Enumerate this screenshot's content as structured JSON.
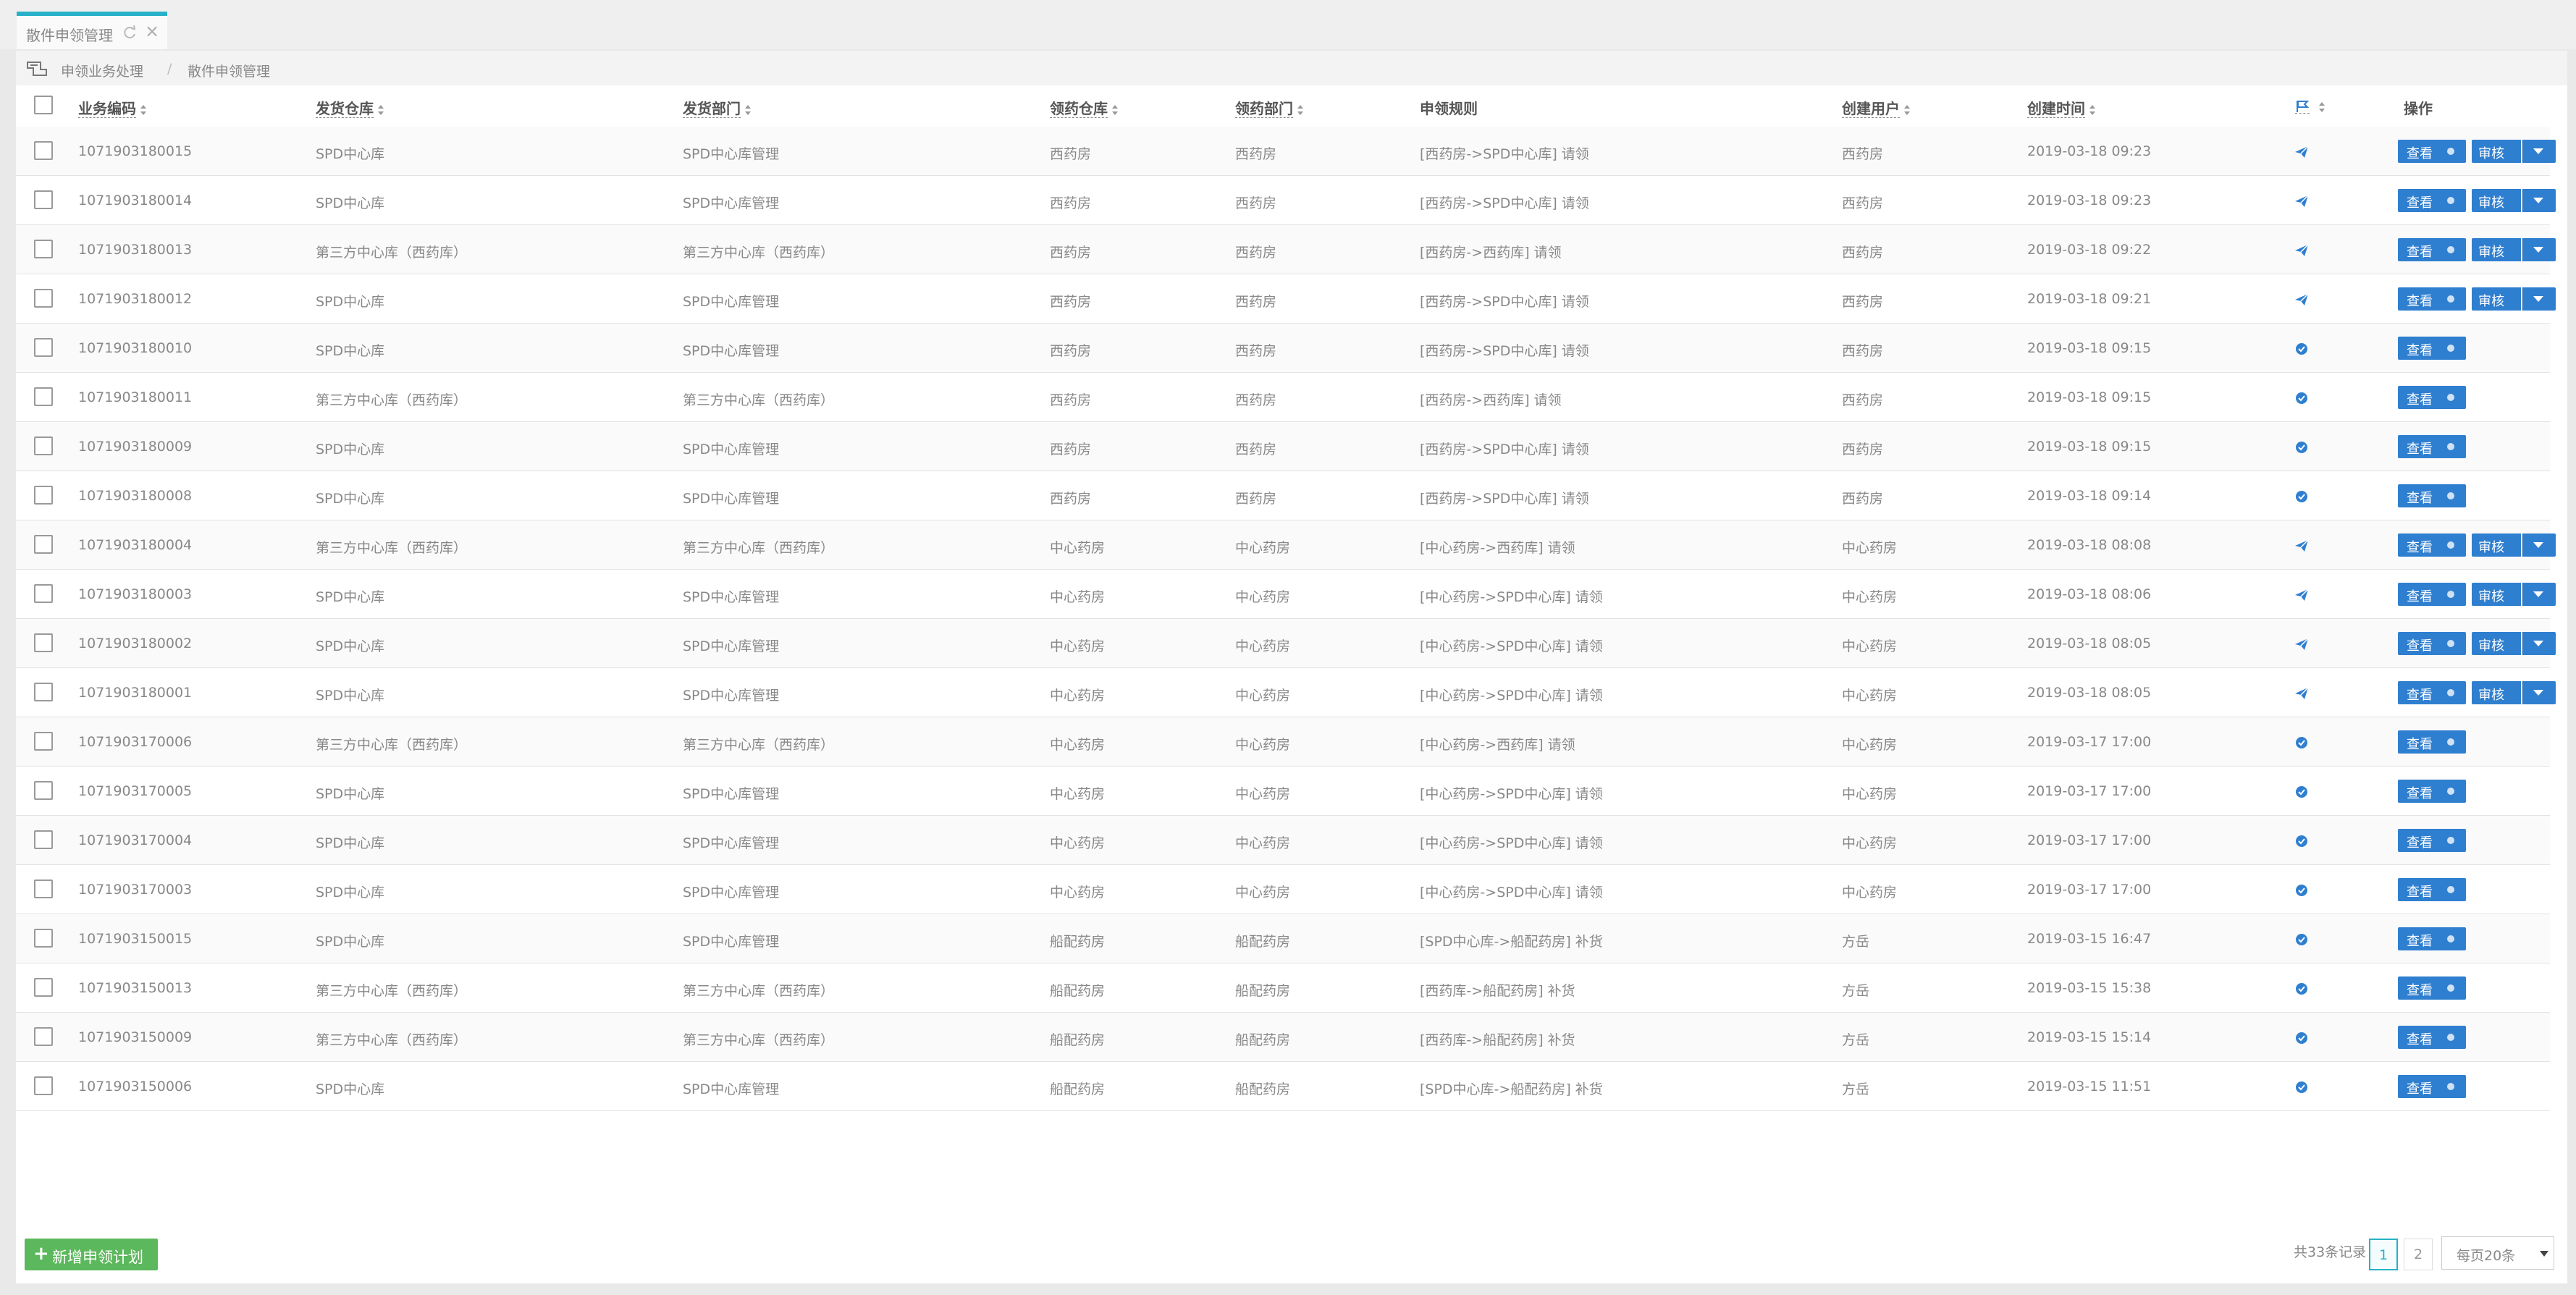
{
  "tab": {
    "label": "散件申领管理"
  },
  "breadcrumb": {
    "items": [
      "申领业务处理",
      "散件申领管理"
    ],
    "separator": "/"
  },
  "grid": {
    "columns": {
      "code": "业务编码",
      "src_wh": "发货仓库",
      "src_dept": "发货部门",
      "dst_wh": "领药仓库",
      "dst_dept": "领药部门",
      "rule": "申领规则",
      "user": "创建用户",
      "time": "创建时间",
      "actions": "操作"
    },
    "view_label": "查看",
    "audit_label": "审核",
    "rows": [
      {
        "code": "1071903180015",
        "src_wh": "SPD中心库",
        "src_dept": "SPD中心库管理",
        "dst_wh": "西药房",
        "dst_dept": "西药房",
        "rule": "[西药房->SPD中心库] 请领",
        "user": "西药房",
        "time": "2019-03-18 09:23",
        "status": "sent"
      },
      {
        "code": "1071903180014",
        "src_wh": "SPD中心库",
        "src_dept": "SPD中心库管理",
        "dst_wh": "西药房",
        "dst_dept": "西药房",
        "rule": "[西药房->SPD中心库] 请领",
        "user": "西药房",
        "time": "2019-03-18 09:23",
        "status": "sent"
      },
      {
        "code": "1071903180013",
        "src_wh": "第三方中心库（西药库）",
        "src_dept": "第三方中心库（西药库）",
        "dst_wh": "西药房",
        "dst_dept": "西药房",
        "rule": "[西药房->西药库] 请领",
        "user": "西药房",
        "time": "2019-03-18 09:22",
        "status": "sent"
      },
      {
        "code": "1071903180012",
        "src_wh": "SPD中心库",
        "src_dept": "SPD中心库管理",
        "dst_wh": "西药房",
        "dst_dept": "西药房",
        "rule": "[西药房->SPD中心库] 请领",
        "user": "西药房",
        "time": "2019-03-18 09:21",
        "status": "sent"
      },
      {
        "code": "1071903180010",
        "src_wh": "SPD中心库",
        "src_dept": "SPD中心库管理",
        "dst_wh": "西药房",
        "dst_dept": "西药房",
        "rule": "[西药房->SPD中心库] 请领",
        "user": "西药房",
        "time": "2019-03-18 09:15",
        "status": "done"
      },
      {
        "code": "1071903180011",
        "src_wh": "第三方中心库（西药库）",
        "src_dept": "第三方中心库（西药库）",
        "dst_wh": "西药房",
        "dst_dept": "西药房",
        "rule": "[西药房->西药库] 请领",
        "user": "西药房",
        "time": "2019-03-18 09:15",
        "status": "done"
      },
      {
        "code": "1071903180009",
        "src_wh": "SPD中心库",
        "src_dept": "SPD中心库管理",
        "dst_wh": "西药房",
        "dst_dept": "西药房",
        "rule": "[西药房->SPD中心库] 请领",
        "user": "西药房",
        "time": "2019-03-18 09:15",
        "status": "done"
      },
      {
        "code": "1071903180008",
        "src_wh": "SPD中心库",
        "src_dept": "SPD中心库管理",
        "dst_wh": "西药房",
        "dst_dept": "西药房",
        "rule": "[西药房->SPD中心库] 请领",
        "user": "西药房",
        "time": "2019-03-18 09:14",
        "status": "done"
      },
      {
        "code": "1071903180004",
        "src_wh": "第三方中心库（西药库）",
        "src_dept": "第三方中心库（西药库）",
        "dst_wh": "中心药房",
        "dst_dept": "中心药房",
        "rule": "[中心药房->西药库] 请领",
        "user": "中心药房",
        "time": "2019-03-18 08:08",
        "status": "sent"
      },
      {
        "code": "1071903180003",
        "src_wh": "SPD中心库",
        "src_dept": "SPD中心库管理",
        "dst_wh": "中心药房",
        "dst_dept": "中心药房",
        "rule": "[中心药房->SPD中心库] 请领",
        "user": "中心药房",
        "time": "2019-03-18 08:06",
        "status": "sent"
      },
      {
        "code": "1071903180002",
        "src_wh": "SPD中心库",
        "src_dept": "SPD中心库管理",
        "dst_wh": "中心药房",
        "dst_dept": "中心药房",
        "rule": "[中心药房->SPD中心库] 请领",
        "user": "中心药房",
        "time": "2019-03-18 08:05",
        "status": "sent"
      },
      {
        "code": "1071903180001",
        "src_wh": "SPD中心库",
        "src_dept": "SPD中心库管理",
        "dst_wh": "中心药房",
        "dst_dept": "中心药房",
        "rule": "[中心药房->SPD中心库] 请领",
        "user": "中心药房",
        "time": "2019-03-18 08:05",
        "status": "sent"
      },
      {
        "code": "1071903170006",
        "src_wh": "第三方中心库（西药库）",
        "src_dept": "第三方中心库（西药库）",
        "dst_wh": "中心药房",
        "dst_dept": "中心药房",
        "rule": "[中心药房->西药库] 请领",
        "user": "中心药房",
        "time": "2019-03-17 17:00",
        "status": "done"
      },
      {
        "code": "1071903170005",
        "src_wh": "SPD中心库",
        "src_dept": "SPD中心库管理",
        "dst_wh": "中心药房",
        "dst_dept": "中心药房",
        "rule": "[中心药房->SPD中心库] 请领",
        "user": "中心药房",
        "time": "2019-03-17 17:00",
        "status": "done"
      },
      {
        "code": "1071903170004",
        "src_wh": "SPD中心库",
        "src_dept": "SPD中心库管理",
        "dst_wh": "中心药房",
        "dst_dept": "中心药房",
        "rule": "[中心药房->SPD中心库] 请领",
        "user": "中心药房",
        "time": "2019-03-17 17:00",
        "status": "done"
      },
      {
        "code": "1071903170003",
        "src_wh": "SPD中心库",
        "src_dept": "SPD中心库管理",
        "dst_wh": "中心药房",
        "dst_dept": "中心药房",
        "rule": "[中心药房->SPD中心库] 请领",
        "user": "中心药房",
        "time": "2019-03-17 17:00",
        "status": "done"
      },
      {
        "code": "1071903150015",
        "src_wh": "SPD中心库",
        "src_dept": "SPD中心库管理",
        "dst_wh": "船配药房",
        "dst_dept": "船配药房",
        "rule": "[SPD中心库->船配药房] 补货",
        "user": "方岳",
        "time": "2019-03-15 16:47",
        "status": "done"
      },
      {
        "code": "1071903150013",
        "src_wh": "第三方中心库（西药库）",
        "src_dept": "第三方中心库（西药库）",
        "dst_wh": "船配药房",
        "dst_dept": "船配药房",
        "rule": "[西药库->船配药房] 补货",
        "user": "方岳",
        "time": "2019-03-15 15:38",
        "status": "done"
      },
      {
        "code": "1071903150009",
        "src_wh": "第三方中心库（西药库）",
        "src_dept": "第三方中心库（西药库）",
        "dst_wh": "船配药房",
        "dst_dept": "船配药房",
        "rule": "[西药库->船配药房] 补货",
        "user": "方岳",
        "time": "2019-03-15 15:14",
        "status": "done"
      },
      {
        "code": "1071903150006",
        "src_wh": "SPD中心库",
        "src_dept": "SPD中心库管理",
        "dst_wh": "船配药房",
        "dst_dept": "船配药房",
        "rule": "[SPD中心库->船配药房] 补货",
        "user": "方岳",
        "time": "2019-03-15 11:51",
        "status": "done"
      }
    ]
  },
  "footer": {
    "add_label": "新增申领计划",
    "total_text": "共33条记录",
    "pages": [
      "1",
      "2"
    ],
    "active_page": "1",
    "page_size_label": "每页20条"
  },
  "colors": {
    "accent": "#27b1c7",
    "primary": "#2f7fd0",
    "success": "#5cb85c"
  },
  "icons": {
    "status_sent": "paper-plane-icon",
    "status_done": "check-circle-icon",
    "column_flag": "flag-icon"
  }
}
